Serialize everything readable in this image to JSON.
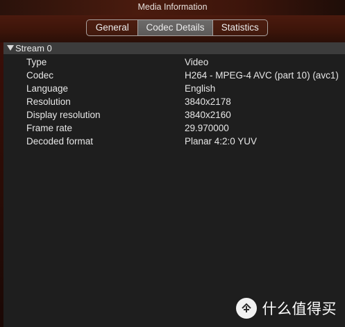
{
  "window": {
    "title": "Media Information"
  },
  "tabs": [
    {
      "label": "General",
      "active": false
    },
    {
      "label": "Codec Details",
      "active": true
    },
    {
      "label": "Statistics",
      "active": false
    }
  ],
  "stream": {
    "label": "Stream 0",
    "rows": [
      {
        "key": "Type",
        "value": "Video"
      },
      {
        "key": "Codec",
        "value": "H264 - MPEG-4 AVC (part 10) (avc1)"
      },
      {
        "key": "Language",
        "value": "English"
      },
      {
        "key": "Resolution",
        "value": "3840x2178"
      },
      {
        "key": "Display resolution",
        "value": "3840x2160"
      },
      {
        "key": "Frame rate",
        "value": "29.970000"
      },
      {
        "key": "Decoded format",
        "value": "Planar 4:2:0 YUV"
      }
    ]
  },
  "watermark": {
    "text": "什么值得买",
    "icon": "value-badge-icon"
  },
  "colors": {
    "titlebar": "#3d150b",
    "active_tab": "#666463",
    "content_bg": "#1e1e1e",
    "stream_header": "#3c3c3c",
    "text": "#e7e7e7"
  }
}
